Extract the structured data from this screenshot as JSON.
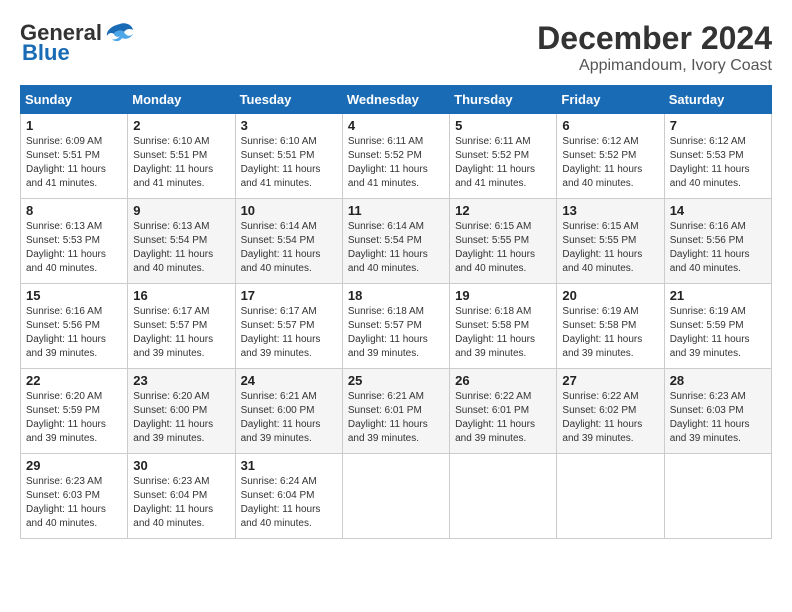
{
  "header": {
    "logo_line1": "General",
    "logo_line2": "Blue",
    "month": "December 2024",
    "location": "Appimandoum, Ivory Coast"
  },
  "days_of_week": [
    "Sunday",
    "Monday",
    "Tuesday",
    "Wednesday",
    "Thursday",
    "Friday",
    "Saturday"
  ],
  "weeks": [
    [
      {
        "day": "1",
        "sunrise": "6:09 AM",
        "sunset": "5:51 PM",
        "daylight": "11 hours and 41 minutes."
      },
      {
        "day": "2",
        "sunrise": "6:10 AM",
        "sunset": "5:51 PM",
        "daylight": "11 hours and 41 minutes."
      },
      {
        "day": "3",
        "sunrise": "6:10 AM",
        "sunset": "5:51 PM",
        "daylight": "11 hours and 41 minutes."
      },
      {
        "day": "4",
        "sunrise": "6:11 AM",
        "sunset": "5:52 PM",
        "daylight": "11 hours and 41 minutes."
      },
      {
        "day": "5",
        "sunrise": "6:11 AM",
        "sunset": "5:52 PM",
        "daylight": "11 hours and 41 minutes."
      },
      {
        "day": "6",
        "sunrise": "6:12 AM",
        "sunset": "5:52 PM",
        "daylight": "11 hours and 40 minutes."
      },
      {
        "day": "7",
        "sunrise": "6:12 AM",
        "sunset": "5:53 PM",
        "daylight": "11 hours and 40 minutes."
      }
    ],
    [
      {
        "day": "8",
        "sunrise": "6:13 AM",
        "sunset": "5:53 PM",
        "daylight": "11 hours and 40 minutes."
      },
      {
        "day": "9",
        "sunrise": "6:13 AM",
        "sunset": "5:54 PM",
        "daylight": "11 hours and 40 minutes."
      },
      {
        "day": "10",
        "sunrise": "6:14 AM",
        "sunset": "5:54 PM",
        "daylight": "11 hours and 40 minutes."
      },
      {
        "day": "11",
        "sunrise": "6:14 AM",
        "sunset": "5:54 PM",
        "daylight": "11 hours and 40 minutes."
      },
      {
        "day": "12",
        "sunrise": "6:15 AM",
        "sunset": "5:55 PM",
        "daylight": "11 hours and 40 minutes."
      },
      {
        "day": "13",
        "sunrise": "6:15 AM",
        "sunset": "5:55 PM",
        "daylight": "11 hours and 40 minutes."
      },
      {
        "day": "14",
        "sunrise": "6:16 AM",
        "sunset": "5:56 PM",
        "daylight": "11 hours and 40 minutes."
      }
    ],
    [
      {
        "day": "15",
        "sunrise": "6:16 AM",
        "sunset": "5:56 PM",
        "daylight": "11 hours and 39 minutes."
      },
      {
        "day": "16",
        "sunrise": "6:17 AM",
        "sunset": "5:57 PM",
        "daylight": "11 hours and 39 minutes."
      },
      {
        "day": "17",
        "sunrise": "6:17 AM",
        "sunset": "5:57 PM",
        "daylight": "11 hours and 39 minutes."
      },
      {
        "day": "18",
        "sunrise": "6:18 AM",
        "sunset": "5:57 PM",
        "daylight": "11 hours and 39 minutes."
      },
      {
        "day": "19",
        "sunrise": "6:18 AM",
        "sunset": "5:58 PM",
        "daylight": "11 hours and 39 minutes."
      },
      {
        "day": "20",
        "sunrise": "6:19 AM",
        "sunset": "5:58 PM",
        "daylight": "11 hours and 39 minutes."
      },
      {
        "day": "21",
        "sunrise": "6:19 AM",
        "sunset": "5:59 PM",
        "daylight": "11 hours and 39 minutes."
      }
    ],
    [
      {
        "day": "22",
        "sunrise": "6:20 AM",
        "sunset": "5:59 PM",
        "daylight": "11 hours and 39 minutes."
      },
      {
        "day": "23",
        "sunrise": "6:20 AM",
        "sunset": "6:00 PM",
        "daylight": "11 hours and 39 minutes."
      },
      {
        "day": "24",
        "sunrise": "6:21 AM",
        "sunset": "6:00 PM",
        "daylight": "11 hours and 39 minutes."
      },
      {
        "day": "25",
        "sunrise": "6:21 AM",
        "sunset": "6:01 PM",
        "daylight": "11 hours and 39 minutes."
      },
      {
        "day": "26",
        "sunrise": "6:22 AM",
        "sunset": "6:01 PM",
        "daylight": "11 hours and 39 minutes."
      },
      {
        "day": "27",
        "sunrise": "6:22 AM",
        "sunset": "6:02 PM",
        "daylight": "11 hours and 39 minutes."
      },
      {
        "day": "28",
        "sunrise": "6:23 AM",
        "sunset": "6:03 PM",
        "daylight": "11 hours and 39 minutes."
      }
    ],
    [
      {
        "day": "29",
        "sunrise": "6:23 AM",
        "sunset": "6:03 PM",
        "daylight": "11 hours and 40 minutes."
      },
      {
        "day": "30",
        "sunrise": "6:23 AM",
        "sunset": "6:04 PM",
        "daylight": "11 hours and 40 minutes."
      },
      {
        "day": "31",
        "sunrise": "6:24 AM",
        "sunset": "6:04 PM",
        "daylight": "11 hours and 40 minutes."
      },
      null,
      null,
      null,
      null
    ]
  ]
}
